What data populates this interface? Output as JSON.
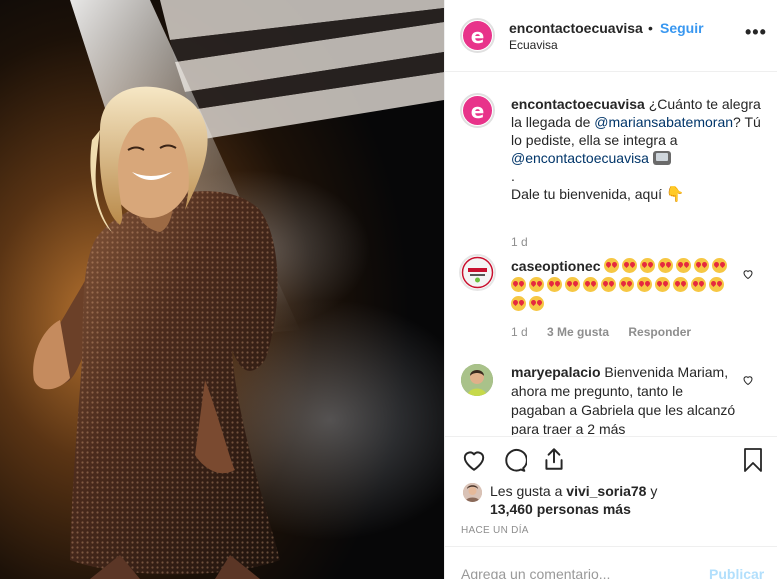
{
  "header": {
    "username": "encontactoecuavisa",
    "separator": "•",
    "follow_label": "Seguir",
    "location": "Ecuavisa",
    "more_label": "•••",
    "avatar_letter": "e"
  },
  "caption": {
    "username": "encontactoecuavisa",
    "text_1": " ¿Cuánto te alegra la llegada de ",
    "mention_1": "@mariansabatemoran",
    "text_2": "? Tú lo pediste, ella se integra a ",
    "mention_2": "@encontactoecuavisa",
    "line_dot": ".",
    "text_3": "Dale tu bienvenida, aquí",
    "time": "1 d"
  },
  "comments": [
    {
      "username": "caseoptionec",
      "emoji_count": 21,
      "time": "1 d",
      "likes": "3 Me gusta",
      "reply": "Responder"
    },
    {
      "username": "maryepalacio",
      "text": " Bienvenida Mariam, ahora me pregunto, tanto le pagaban a Gabriela que les alcanzó para traer a 2 más"
    }
  ],
  "likes": {
    "prefix": "Les gusta a ",
    "user": "vivi_soria78",
    "joiner": " y",
    "count": "13,460 personas más"
  },
  "posted_ago": "HACE UN DÍA",
  "add_comment": {
    "placeholder": "Agrega un comentario...",
    "post_label": "Publicar"
  },
  "icons": {
    "like": "heart-icon",
    "comment": "comment-icon",
    "share": "share-icon",
    "save": "bookmark-icon"
  },
  "colors": {
    "accent": "#3897f0",
    "brand": "#e8338a",
    "mention": "#003569",
    "muted": "#8e8e8e"
  }
}
